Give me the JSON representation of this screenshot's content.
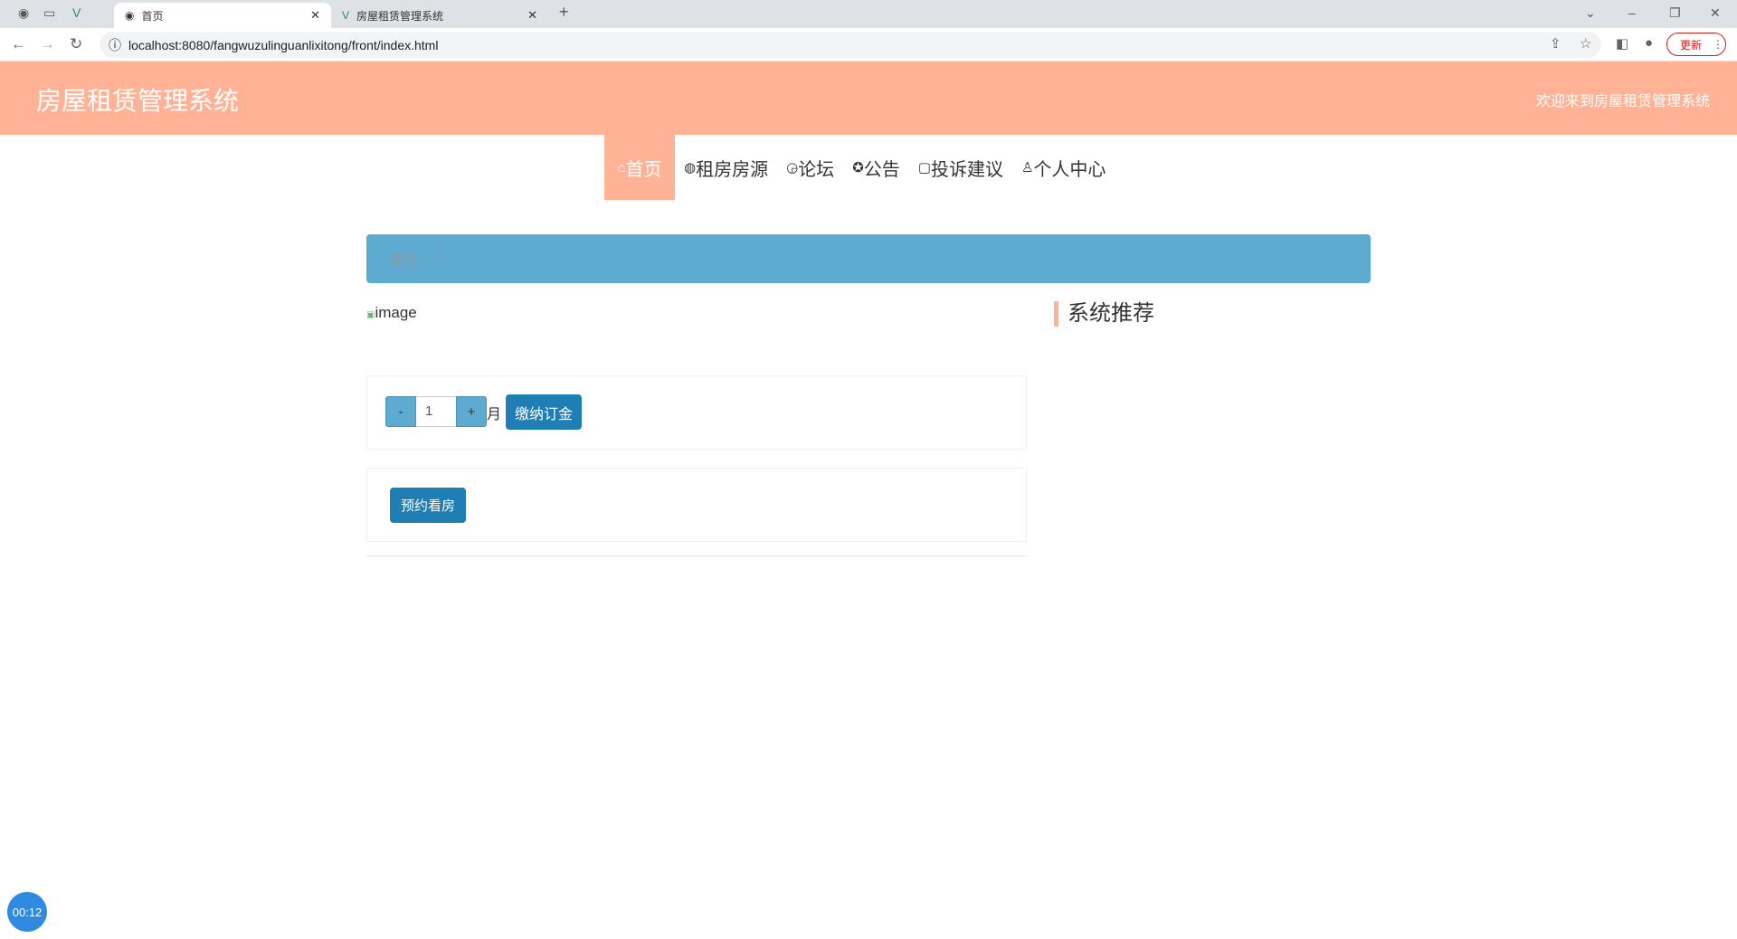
{
  "browser": {
    "tabs": [
      {
        "label": "首页"
      },
      {
        "label": "房屋租赁管理系统"
      }
    ],
    "url": "localhost:8080/fangwuzulinguanlixitong/front/index.html",
    "update_label": "更新"
  },
  "header": {
    "title": "房屋租赁管理系统",
    "welcome": "欢迎来到房屋租赁管理系统"
  },
  "nav": {
    "items": [
      {
        "icon": "⌂",
        "label": "首页"
      },
      {
        "icon": "◍",
        "label": "租房房源"
      },
      {
        "icon": "◶",
        "label": "论坛"
      },
      {
        "icon": "✪",
        "label": "公告"
      },
      {
        "icon": "▢",
        "label": "投诉建议"
      },
      {
        "icon": "♙",
        "label": "个人中心"
      }
    ]
  },
  "breadcrumb": {
    "item": "首页",
    "separator": "/"
  },
  "main": {
    "image_alt": "image",
    "stepper": {
      "minus": "-",
      "value": "1",
      "plus": "+",
      "unit": "月"
    },
    "pay_deposit": "缴纳订金",
    "book_viewing": "预约看房"
  },
  "sidebar": {
    "title": "系统推荐"
  },
  "recorder": {
    "time": "00:12"
  },
  "colors": {
    "accent": "#ffb295",
    "breadcrumb": "#5eabd1",
    "button": "#1f7eb4"
  }
}
